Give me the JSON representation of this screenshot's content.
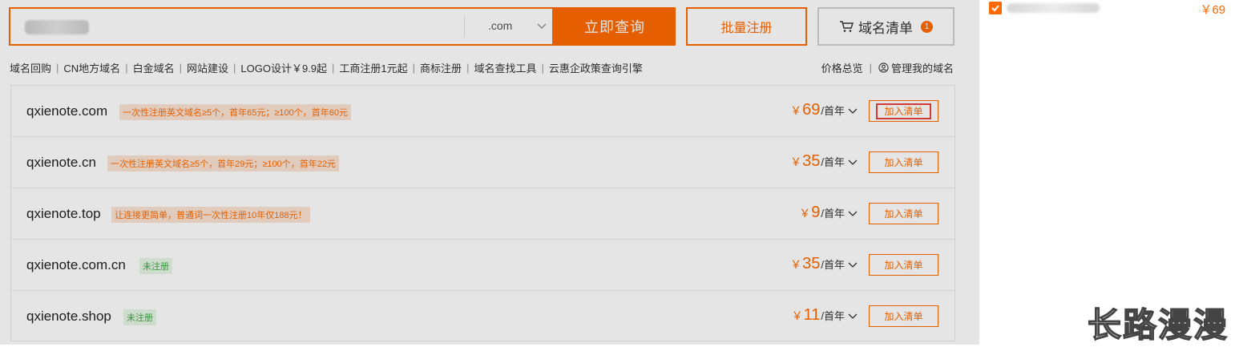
{
  "search": {
    "input_value": "",
    "suffix": ".com",
    "query_button": "立即查询",
    "batch_button": "批量注册",
    "list_button": "域名清单",
    "list_count": "1"
  },
  "nav_links": [
    "域名回购",
    "CN地方域名",
    "白金域名",
    "网站建设",
    "LOGO设计￥9.9起",
    "工商注册1元起",
    "商标注册",
    "域名查找工具",
    "云惠企政策查询引擎"
  ],
  "right_links": {
    "price_overview": "价格总览",
    "manage_domains": "管理我的域名"
  },
  "results": [
    {
      "domain": "qxienote.com",
      "tag": "一次性注册英文域名≥5个，首年65元；≥100个，首年60元",
      "tag_type": "promo",
      "currency": "￥",
      "price": "69",
      "unit": "/首年",
      "add_label": "加入清单"
    },
    {
      "domain": "qxienote.cn",
      "tag": "一次性注册英文域名≥5个，首年29元；≥100个，首年22元",
      "tag_type": "promo",
      "currency": "￥",
      "price": "35",
      "unit": "/首年",
      "add_label": "加入清单"
    },
    {
      "domain": "qxienote.top",
      "tag": "让连接更简单，普通词一次性注册10年仅188元！",
      "tag_type": "promo",
      "currency": "￥",
      "price": "9",
      "unit": "/首年",
      "add_label": "加入清单"
    },
    {
      "domain": "qxienote.com.cn",
      "tag": "未注册",
      "tag_type": "status",
      "currency": "￥",
      "price": "35",
      "unit": "/首年",
      "add_label": "加入清单"
    },
    {
      "domain": "qxienote.shop",
      "tag": "未注册",
      "tag_type": "status",
      "currency": "￥",
      "price": "11",
      "unit": "/首年",
      "add_label": "加入清单"
    }
  ],
  "side_panel": {
    "price": "￥69"
  },
  "watermark": "长路漫漫",
  "colors": {
    "accent": "#ff6a00",
    "status_green": "#3fa33f",
    "focus_red": "#e8423b"
  }
}
